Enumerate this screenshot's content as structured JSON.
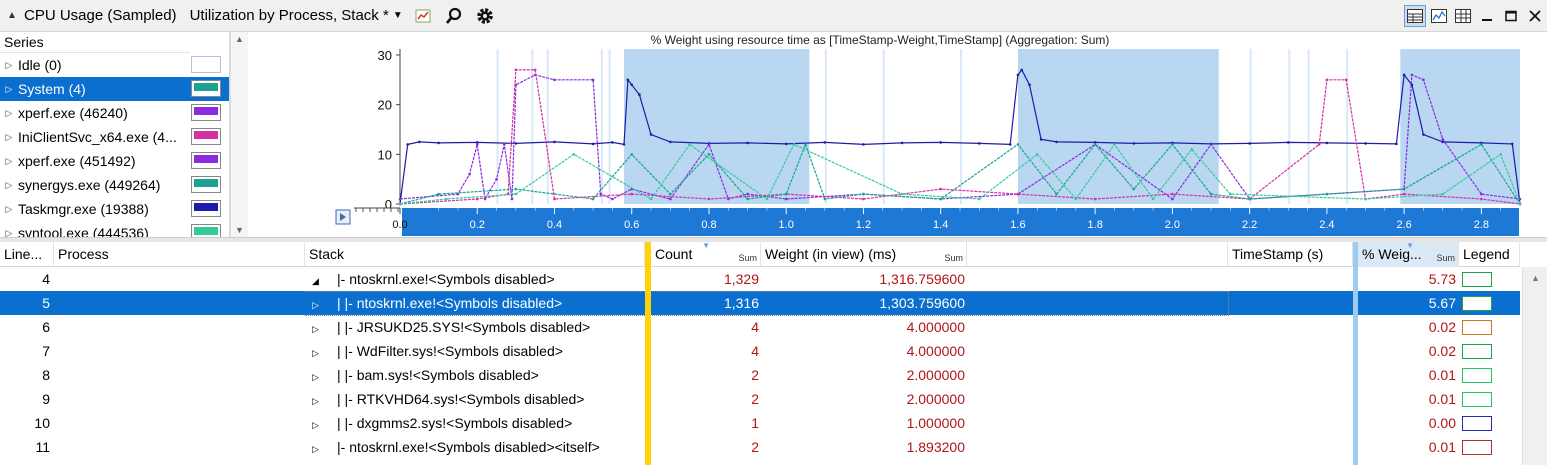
{
  "titlebar": {
    "title": "CPU Usage (Sampled)",
    "subtitle": "Utilization by Process, Stack *",
    "collapse_icon": "▲",
    "dropdown_icon": "▼"
  },
  "series_panel": {
    "header": "Series",
    "items": [
      {
        "label": "Idle (0)",
        "color": "#c8b4e6",
        "selected": false
      },
      {
        "label": "System (4)",
        "color": "#1aa391",
        "selected": true
      },
      {
        "label": "xperf.exe (46240)",
        "color": "#8a2be2",
        "selected": false
      },
      {
        "label": "IniClientSvc_x64.exe (4...",
        "color": "#d62fa6",
        "selected": false
      },
      {
        "label": "xperf.exe (451492)",
        "color": "#8a2be2",
        "selected": false
      },
      {
        "label": "synergys.exe (449264)",
        "color": "#1aa391",
        "selected": false
      },
      {
        "label": "Taskmgr.exe (19388)",
        "color": "#1c1ca8",
        "selected": false
      },
      {
        "label": "svntool.exe (444536)",
        "color": "#33cc99",
        "selected": false
      }
    ]
  },
  "chart_data": {
    "type": "line",
    "title": "% Weight using resource time as [TimeStamp-Weight,TimeStamp] (Aggregation: Sum)",
    "xlim": [
      0.0,
      2.9
    ],
    "ylim": [
      0,
      30
    ],
    "y_ticks": [
      "0",
      "10",
      "20",
      "30"
    ],
    "x_ticks": [
      "0.0",
      "0.2",
      "0.4",
      "0.6",
      "0.8",
      "1.0",
      "1.2",
      "1.4",
      "1.6",
      "1.8",
      "2.0",
      "2.2",
      "2.4",
      "2.6",
      "2.8"
    ],
    "x_tick_values": [
      0.0,
      0.2,
      0.4,
      0.6,
      0.8,
      1.0,
      1.2,
      1.4,
      1.6,
      1.8,
      2.0,
      2.2,
      2.4,
      2.6,
      2.8
    ],
    "selection_ranges": [
      [
        0.58,
        1.06
      ],
      [
        1.6,
        2.12
      ],
      [
        2.59,
        2.9
      ]
    ],
    "grid": false,
    "series": [
      {
        "color": "#1c1ca8",
        "x": [
          0.0,
          0.02,
          0.05,
          0.1,
          0.2,
          0.3,
          0.4,
          0.5,
          0.55,
          0.58,
          0.59,
          0.6,
          0.62,
          0.65,
          0.7,
          0.8,
          0.9,
          1.0,
          1.1,
          1.2,
          1.3,
          1.4,
          1.5,
          1.58,
          1.6,
          1.61,
          1.63,
          1.66,
          1.7,
          1.8,
          1.9,
          2.0,
          2.1,
          2.2,
          2.3,
          2.4,
          2.5,
          2.58,
          2.6,
          2.62,
          2.65,
          2.7,
          2.8,
          2.88,
          2.9
        ],
        "values": [
          0,
          12,
          12.5,
          12.3,
          12.4,
          12.2,
          12.5,
          12.1,
          12.4,
          12.0,
          25,
          24,
          22,
          14,
          12.5,
          12.2,
          12.3,
          12.1,
          12.4,
          12.0,
          12.3,
          12.4,
          12.2,
          12.0,
          26,
          27,
          24,
          13,
          12.5,
          12.4,
          12.2,
          12.3,
          12.1,
          12.2,
          12.4,
          12.3,
          12.2,
          12.1,
          26,
          24,
          14,
          12.5,
          12.3,
          12.1,
          0
        ]
      },
      {
        "color": "#8a2be2",
        "x": [
          0.0,
          0.15,
          0.18,
          0.2,
          0.22,
          0.25,
          0.27,
          0.29,
          0.3,
          0.35,
          0.4,
          0.5,
          0.52,
          0.55,
          0.6,
          0.7,
          0.8,
          0.85,
          0.9,
          1.0,
          1.2,
          1.4,
          1.6,
          1.8,
          2.0,
          2.1,
          2.2,
          2.4,
          2.6,
          2.62,
          2.65,
          2.7,
          2.8,
          2.9
        ],
        "values": [
          1,
          2,
          6,
          12,
          1,
          5,
          12,
          1,
          24,
          26,
          25,
          25,
          2,
          1,
          3,
          1,
          12,
          1,
          2,
          1,
          2,
          1,
          2,
          12,
          1,
          12,
          1,
          2,
          3,
          26,
          25,
          13,
          2,
          1
        ]
      },
      {
        "color": "#d62fa6",
        "x": [
          0.0,
          0.2,
          0.28,
          0.3,
          0.35,
          0.4,
          0.6,
          0.8,
          1.0,
          1.2,
          1.4,
          1.6,
          1.8,
          2.0,
          2.2,
          2.38,
          2.4,
          2.45,
          2.5,
          2.6,
          2.8,
          2.9
        ],
        "values": [
          0,
          1,
          2,
          27,
          27,
          1,
          2,
          1,
          2,
          1,
          3,
          2,
          1,
          2,
          1,
          12,
          25,
          25,
          1,
          2,
          1,
          0
        ]
      },
      {
        "color": "#1aa391",
        "x": [
          0.0,
          0.1,
          0.3,
          0.5,
          0.6,
          0.7,
          0.8,
          0.9,
          1.0,
          1.05,
          1.1,
          1.2,
          1.4,
          1.6,
          1.7,
          1.8,
          1.9,
          2.0,
          2.1,
          2.2,
          2.4,
          2.6,
          2.8,
          2.9
        ],
        "values": [
          0,
          2,
          3,
          1,
          10,
          2,
          10,
          1,
          2,
          12,
          1,
          2,
          1,
          12,
          2,
          12,
          3,
          12,
          2,
          1,
          2,
          3,
          12,
          0
        ]
      },
      {
        "color": "#33cc99",
        "x": [
          0.0,
          0.12,
          0.3,
          0.45,
          0.65,
          0.75,
          0.95,
          1.02,
          1.3,
          1.5,
          1.65,
          1.75,
          1.85,
          1.95,
          2.05,
          2.15,
          2.5,
          2.7,
          2.85,
          2.9
        ],
        "values": [
          0,
          1,
          2,
          10,
          1,
          12,
          1,
          12,
          2,
          1,
          10,
          1,
          12,
          1,
          11,
          2,
          1,
          2,
          10,
          0
        ]
      }
    ]
  },
  "table": {
    "headers": {
      "line": "Line...",
      "process": "Process",
      "stack": "Stack",
      "count": "Count",
      "count_sum": "Sum",
      "weight": "Weight (in view) (ms)",
      "weight_sum": "Sum",
      "timestamp": "TimeStamp (s)",
      "pct": "% Weig...",
      "pct_sum": "Sum",
      "legend": "Legend"
    },
    "rows": [
      {
        "line": "4",
        "stack": "|- ntoskrnl.exe!<Symbols disabled>",
        "expander": "◢",
        "indent": 0,
        "count": "1,329",
        "weight": "1,316.759600",
        "pct": "5.73",
        "legend_color": "#1aa34a",
        "selected": false
      },
      {
        "line": "5",
        "stack": "|    |- ntoskrnl.exe!<Symbols disabled>",
        "expander": "▷",
        "indent": 1,
        "count": "1,316",
        "weight": "1,303.759600",
        "pct": "5.67",
        "legend_color": "#1aa34a",
        "selected": true
      },
      {
        "line": "6",
        "stack": "|    |- JRSUKD25.SYS!<Symbols disabled>",
        "expander": "▷",
        "indent": 1,
        "count": "4",
        "weight": "4.000000",
        "pct": "0.02",
        "legend_color": "#c8781e",
        "selected": false
      },
      {
        "line": "7",
        "stack": "|    |- WdFilter.sys!<Symbols disabled>",
        "expander": "▷",
        "indent": 1,
        "count": "4",
        "weight": "4.000000",
        "pct": "0.02",
        "legend_color": "#1aa34a",
        "selected": false
      },
      {
        "line": "8",
        "stack": "|    |- bam.sys!<Symbols disabled>",
        "expander": "▷",
        "indent": 1,
        "count": "2",
        "weight": "2.000000",
        "pct": "0.01",
        "legend_color": "#22c55e",
        "selected": false
      },
      {
        "line": "9",
        "stack": "|    |- RTKVHD64.sys!<Symbols disabled>",
        "expander": "▷",
        "indent": 1,
        "count": "2",
        "weight": "2.000000",
        "pct": "0.01",
        "legend_color": "#22c55e",
        "selected": false
      },
      {
        "line": "10",
        "stack": "|    |- dxgmms2.sys!<Symbols disabled>",
        "expander": "▷",
        "indent": 1,
        "count": "1",
        "weight": "1.000000",
        "pct": "0.00",
        "legend_color": "#2a2aa8",
        "selected": false
      },
      {
        "line": "11",
        "stack": "|- ntoskrnl.exe!<Symbols disabled><itself>",
        "expander": "▷",
        "indent": 0,
        "count": "2",
        "weight": "1.893200",
        "pct": "0.01",
        "legend_color": "#a83232",
        "selected": false
      }
    ]
  }
}
